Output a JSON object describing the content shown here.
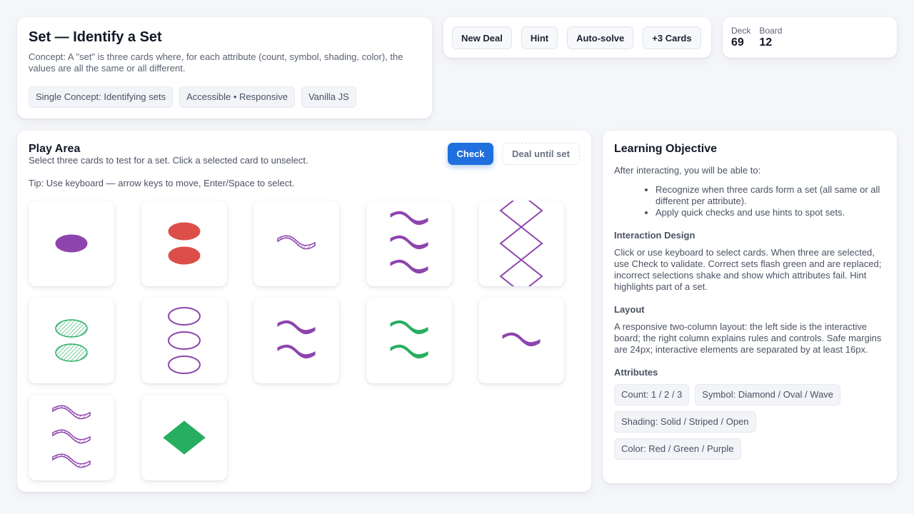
{
  "header": {
    "title": "Set — Identify a Set",
    "concept": "Concept: A \"set\" is three cards where, for each attribute (count, symbol, shading, color), the values are all the same or all different.",
    "chips": [
      "Single Concept: Identifying sets",
      "Accessible • Responsive",
      "Vanilla JS"
    ]
  },
  "actions": {
    "new_deal": "New Deal",
    "hint": "Hint",
    "auto_solve": "Auto-solve",
    "plus_three": "+3 Cards"
  },
  "stats": {
    "deck_label": "Deck",
    "deck_value": "69",
    "board_label": "Board",
    "board_value": "12"
  },
  "play": {
    "title": "Play Area",
    "subtitle": "Select three cards to test for a set. Click a selected card to unselect.",
    "check_label": "Check",
    "deal_until_label": "Deal until set",
    "tip": "Tip: Use keyboard — arrow keys to move, Enter/Space to select."
  },
  "colors": {
    "purple": "#8e44ad",
    "red": "#dc4f48",
    "green": "#27ae60",
    "accent": "#1f6fde"
  },
  "board": [
    {
      "count": 1,
      "symbol": "oval",
      "shading": "solid",
      "color": "purple"
    },
    {
      "count": 2,
      "symbol": "oval",
      "shading": "solid",
      "color": "red"
    },
    {
      "count": 1,
      "symbol": "wave",
      "shading": "striped",
      "color": "purple"
    },
    {
      "count": 3,
      "symbol": "wave",
      "shading": "solid",
      "color": "purple"
    },
    {
      "count": 3,
      "symbol": "diamond",
      "shading": "open",
      "color": "purple"
    },
    {
      "count": 2,
      "symbol": "oval",
      "shading": "striped",
      "color": "green"
    },
    {
      "count": 3,
      "symbol": "oval",
      "shading": "open",
      "color": "purple"
    },
    {
      "count": 2,
      "symbol": "wave",
      "shading": "solid",
      "color": "purple"
    },
    {
      "count": 2,
      "symbol": "wave",
      "shading": "solid",
      "color": "green"
    },
    {
      "count": 1,
      "symbol": "wave",
      "shading": "solid",
      "color": "purple"
    },
    {
      "count": 3,
      "symbol": "wave",
      "shading": "striped",
      "color": "purple"
    },
    {
      "count": 1,
      "symbol": "diamond",
      "shading": "solid",
      "color": "green"
    }
  ],
  "info": {
    "objective_title": "Learning Objective",
    "objective_intro": "After interacting, you will be able to:",
    "objectives": [
      "Recognize when three cards form a set (all same or all different per attribute).",
      "Apply quick checks and use hints to spot sets."
    ],
    "interaction_title": "Interaction Design",
    "interaction_text": "Click or use keyboard to select cards. When three are selected, use Check to validate. Correct sets flash green and are replaced; incorrect selections shake and show which attributes fail. Hint highlights part of a set.",
    "layout_title": "Layout",
    "layout_text": "A responsive two-column layout: the left side is the interactive board; the right column explains rules and controls. Safe margins are 24px; interactive elements are separated by at least 16px.",
    "attributes_title": "Attributes",
    "attributes": [
      "Count: 1 / 2 / 3",
      "Symbol: Diamond / Oval / Wave",
      "Shading: Solid / Striped / Open",
      "Color: Red / Green / Purple"
    ]
  }
}
